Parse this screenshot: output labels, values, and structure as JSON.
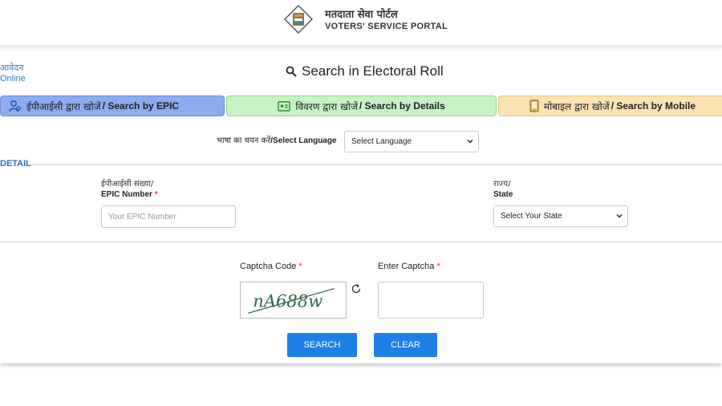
{
  "header": {
    "title_hindi": "मतदाता सेवा पोर्टल",
    "title_english": "VOTERS' SERVICE PORTAL"
  },
  "side_links": [
    "आवेदन",
    "Online"
  ],
  "page": {
    "title": "Search in Electoral Roll"
  },
  "tabs": [
    {
      "hindi": "ईपीआईसी द्वारा खोजें",
      "english": "/ Search by EPIC",
      "active": true,
      "color": "#8eaaf0"
    },
    {
      "hindi": "विवरण द्वारा खोजें",
      "english": "/ Search by Details",
      "active": false,
      "color": "#c8f1c8"
    },
    {
      "hindi": "मोबाइल द्वारा खोजें",
      "english": "/ Search by Mobile",
      "active": false,
      "color": "#fbe3b2"
    }
  ],
  "language": {
    "label_hindi": "भाषा का चयन करें",
    "label_english": "/Select Language",
    "selected": "Select Language"
  },
  "detail": {
    "section_label": "DETAIL",
    "epic": {
      "label_hindi": "ईपीआईसी संख्या/",
      "label_english": "EPIC Number",
      "required": "*",
      "placeholder": "Your EPIC Number",
      "value": ""
    },
    "state": {
      "label_hindi": "राज्य/",
      "label_english": "State",
      "selected": "Select Your State"
    }
  },
  "captcha": {
    "code_label": "Captcha Code",
    "enter_label": "Enter Captcha",
    "required": "*",
    "code_text": "nA688w",
    "entered_value": ""
  },
  "buttons": {
    "search": "SEARCH",
    "clear": "CLEAR"
  },
  "colors": {
    "accent": "#1e7fe6",
    "link": "#2e7fc9"
  }
}
